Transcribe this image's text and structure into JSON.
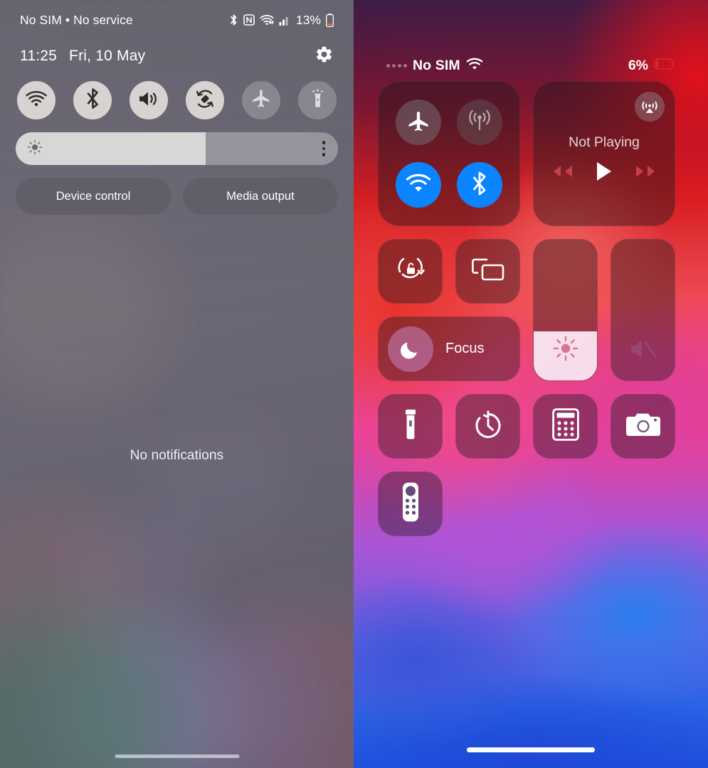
{
  "android": {
    "status_bar": {
      "carrier": "No SIM • No service",
      "battery_percent": "13%",
      "icons": [
        "bluetooth-icon",
        "nfc-icon",
        "wifi-icon",
        "signal-bars-icon",
        "battery-icon"
      ]
    },
    "time": "11:25",
    "date": "Fri, 10 May",
    "settings_icon": "gear-icon",
    "toggles": [
      {
        "name": "wifi",
        "icon": "wifi-icon",
        "state": "on"
      },
      {
        "name": "bluetooth",
        "icon": "bluetooth-icon",
        "state": "on"
      },
      {
        "name": "sound",
        "icon": "volume-icon",
        "state": "on"
      },
      {
        "name": "auto-rotate",
        "icon": "auto-rotate-icon",
        "state": "on"
      },
      {
        "name": "airplane-mode",
        "icon": "airplane-icon",
        "state": "off"
      },
      {
        "name": "flashlight",
        "icon": "flashlight-icon",
        "state": "off"
      }
    ],
    "brightness": {
      "icon": "brightness-sun-icon",
      "value_percent": 59,
      "overflow_icon": "more-vertical-icon"
    },
    "buttons": [
      {
        "label": "Device control"
      },
      {
        "label": "Media output"
      }
    ],
    "notifications_empty": "No notifications",
    "home_indicator": "home-indicator"
  },
  "ios": {
    "status_bar": {
      "carrier": "No SIM",
      "wifi_icon": "wifi-icon",
      "battery_percent": "6%",
      "battery_icon": "battery-low-icon",
      "battery_color": "#e8231f"
    },
    "connectivity": {
      "items": [
        {
          "name": "airplane-mode",
          "icon": "airplane-icon",
          "state": "off"
        },
        {
          "name": "cellular-data",
          "icon": "cellular-antenna-icon",
          "state": "off"
        },
        {
          "name": "wifi",
          "icon": "wifi-icon",
          "state": "on"
        },
        {
          "name": "bluetooth",
          "icon": "bluetooth-icon",
          "state": "on"
        }
      ],
      "active_color": "#0a84ff"
    },
    "media": {
      "airplay_icon": "airplay-icon",
      "title": "Not Playing",
      "controls": [
        "rewind-icon",
        "play-icon",
        "fast-forward-icon"
      ]
    },
    "tiles": [
      {
        "name": "rotation-lock",
        "icon": "rotation-lock-icon",
        "state": "off"
      },
      {
        "name": "screen-mirroring",
        "icon": "screen-mirroring-icon",
        "state": "off"
      },
      {
        "name": "focus",
        "icon": "moon-icon",
        "label": "Focus",
        "state": "off"
      },
      {
        "name": "flashlight",
        "icon": "flashlight-icon",
        "state": "off"
      },
      {
        "name": "timer",
        "icon": "timer-icon",
        "state": "off"
      },
      {
        "name": "calculator",
        "icon": "calculator-icon",
        "state": "off"
      },
      {
        "name": "camera",
        "icon": "camera-icon",
        "state": "off"
      },
      {
        "name": "apple-tv-remote",
        "icon": "remote-icon",
        "state": "off"
      }
    ],
    "brightness_slider": {
      "icon": "brightness-sun-icon",
      "value_percent": 35
    },
    "volume_slider": {
      "icon": "volume-mute-icon",
      "value_percent": 0
    },
    "home_indicator": "home-indicator"
  }
}
